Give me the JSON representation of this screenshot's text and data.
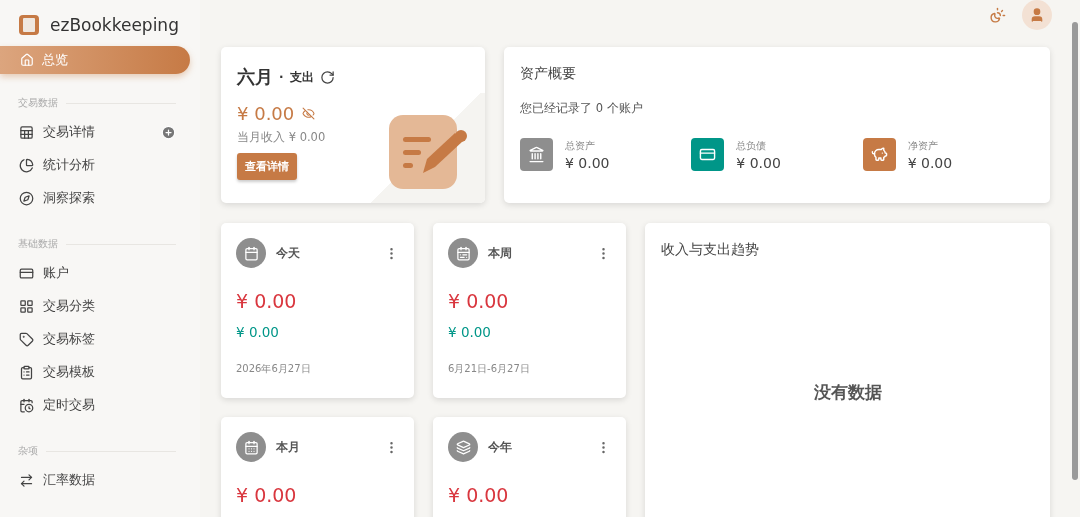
{
  "app": {
    "name": "ezBookkeeping"
  },
  "sidebar": {
    "home": {
      "label": "总览",
      "selected": true
    },
    "sections": [
      {
        "title": "交易数据",
        "items": [
          {
            "label": "交易详情",
            "selected": false,
            "addable": true
          },
          {
            "label": "统计分析",
            "selected": false,
            "addable": false
          },
          {
            "label": "洞察探索",
            "selected": false,
            "addable": false
          }
        ]
      },
      {
        "title": "基础数据",
        "items": [
          {
            "label": "账户",
            "selected": false,
            "addable": false
          },
          {
            "label": "交易分类",
            "selected": false,
            "addable": false
          },
          {
            "label": "交易标签",
            "selected": false,
            "addable": false
          },
          {
            "label": "交易模板",
            "selected": false,
            "addable": false
          },
          {
            "label": "定时交易",
            "selected": false,
            "addable": false
          }
        ]
      },
      {
        "title": "杂项",
        "items": [
          {
            "label": "汇率数据",
            "selected": false,
            "addable": false
          }
        ]
      }
    ]
  },
  "month_card": {
    "title": "六月",
    "separator": "·",
    "subtitle": "支出",
    "amount": "¥ 0.00",
    "amount_hidden": false,
    "income": "当月收入  ¥ 0.00",
    "button": "查看详情"
  },
  "asset_summary": {
    "title": "资产概要",
    "note": "您已经记录了 0 个账户",
    "items": [
      {
        "label": "总资产",
        "value": "¥ 0.00",
        "color": "#8e8e8e"
      },
      {
        "label": "总负债",
        "value": "¥ 0.00",
        "color": "#009688"
      },
      {
        "label": "净资产",
        "value": "¥ 0.00",
        "color": "#c67a45"
      }
    ]
  },
  "period_cards": [
    {
      "title": "今天",
      "expense": "¥ 0.00",
      "income": "¥ 0.00",
      "period": "2026年6月27日"
    },
    {
      "title": "本周",
      "expense": "¥ 0.00",
      "income": "¥ 0.00",
      "period": "6月21日-6月27日"
    },
    {
      "title": "本月",
      "expense": "¥ 0.00"
    },
    {
      "title": "今年",
      "expense": "¥ 0.00"
    }
  ],
  "trend_card": {
    "title": "收入与支出趋势",
    "empty_text": "没有数据"
  }
}
